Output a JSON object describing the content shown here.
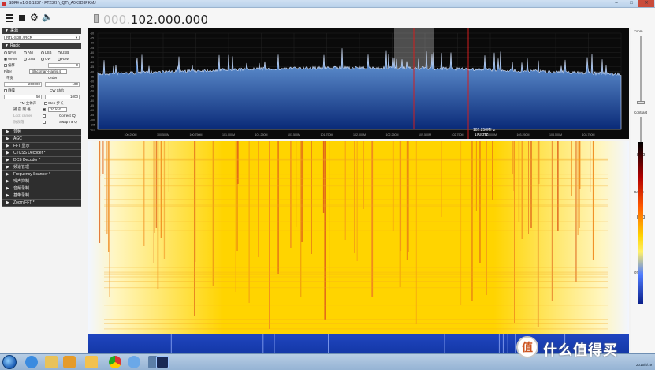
{
  "window": {
    "title": "SDR# v1.0.0.1337 - FT232H\\_QT\\_A0K9D3PKMJ",
    "minimize_icon": "minimize-icon",
    "maximize_icon": "maximize-icon",
    "close_icon": "close-icon"
  },
  "toolbar": {
    "menu_icon": "menu-icon",
    "stop_icon": "stop-icon",
    "settings_icon": "gear-icon",
    "volume_icon": "volume-icon",
    "frequency_dim": "000.",
    "frequency_bright": "102.000.000"
  },
  "left_panel": {
    "source_header": "来源",
    "source_value": "RTL-SDR / RCR",
    "radio_header": "Radio",
    "modes_row1": [
      "NFM",
      "AM",
      "LSB",
      "USB"
    ],
    "modes_row2": [
      "WFM",
      "DSB",
      "CW",
      "RAW"
    ],
    "selected_mode": "WFM",
    "shift_label": "偏移",
    "shift_value": "0",
    "filter_label": "Filter",
    "filter_value": "Blackman-Harris 4",
    "bandwidth_label": "带宽",
    "bandwidth_value": "200000",
    "order_label": "Order",
    "order_value": "100",
    "squelch_label": "静噪",
    "squelch_value": "50",
    "cw_shift_label": "CW Shift",
    "cw_shift_value": "1000",
    "fm_stereo_label": "FM 立体声",
    "snap_label": "Step 步长",
    "snap_to_grid_label": "捕 获 网 格",
    "snap_value": "10 kHz",
    "lock_carrier_label": "Lock carrier",
    "correct_iq_label": "Correct IQ",
    "anti_fading_label": "防衰落",
    "swap_iq_label": "Swap I & Q",
    "collapsed_sections": [
      "音频",
      "AGC",
      "FFT 显示",
      "CTCSS Decoder *",
      "DCS Decoder *",
      "频道管理",
      "Frequency Scanner *",
      "噪声抑制",
      "音频录制",
      "基带录制",
      "Zoom FFT *"
    ]
  },
  "spectrum": {
    "y_labels": [
      "-10",
      "-15",
      "-20",
      "-25",
      "-30",
      "-35",
      "-40",
      "-45",
      "-50",
      "-55",
      "-60",
      "-65",
      "-70",
      "-75",
      "-80",
      "-85",
      "-90",
      "-95",
      "-100",
      "-105",
      "-110"
    ],
    "x_labels": [
      "100.000M",
      "100.250M",
      "100.500M",
      "100.750M",
      "101.000M",
      "101.250M",
      "101.500M",
      "101.750M",
      "102.000M",
      "102.250M",
      "102.500M",
      "102.750M",
      "103.000M",
      "103.250M",
      "103.500M",
      "103.750M",
      "104.000M"
    ],
    "cursor_label_freq": "102.250MHz",
    "cursor_label_bw": "100kHz"
  },
  "right_panel": {
    "zoom_label": "Zoom",
    "contrast_label": "Contrast",
    "range_label": "Range",
    "offset_label": "Offset"
  },
  "taskbar": {
    "start_icon": "windows-start-icon",
    "apps": [
      "ie-icon",
      "explorer-icon",
      "media-player-icon",
      "folder-icon",
      "chrome-icon",
      "paint-icon",
      "image-viewer-icon",
      "sdr-icon"
    ],
    "clock": "2015/5/19"
  },
  "watermark": {
    "badge": "值",
    "text": "什么值得买"
  },
  "colors": {
    "spectrum_bg": "#0a0a0a",
    "spectrum_fill_top": "#6ea2de",
    "spectrum_fill_bottom": "#0a2a78",
    "cursor_line": "#d21e1e",
    "waterfall_hot": "#ffd400",
    "waterfall_cold": "#1438a8",
    "taskbar": "#a9c2de"
  }
}
